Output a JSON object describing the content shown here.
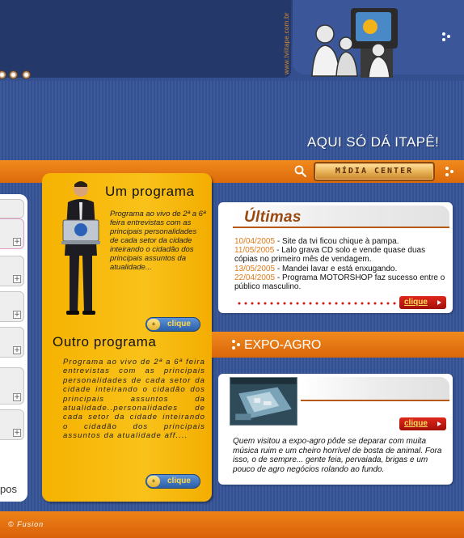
{
  "header": {
    "vertical_url": "www.tviitape.com.br",
    "tagline": "AQUI SÓ DÁ ITAPÊ!"
  },
  "toolbar": {
    "media_center_label": "MÍDIA CENTER"
  },
  "sidebar": {
    "tail_text": "pos"
  },
  "programs": {
    "program1": {
      "title": "Um programa",
      "text": "Programa ao vivo de 2ª a 6ª feira entrevistas com as principais personalidades de cada setor da cidade inteirando o cidadão dos principais assuntos da atualidade...",
      "button_label": "clique"
    },
    "program2": {
      "title": "Outro programa",
      "text": "Programa ao vivo de 2ª a 6ª feira entrevistas com as principais personalidades de cada setor da cidade inteirando o cidadão dos principais assuntos da atualidade..personalidades de cada setor da cidade inteirando o cidadão dos principais assuntos da atualidade aff....",
      "button_label": "clique"
    }
  },
  "ultimas": {
    "title": "Últimas",
    "news": [
      {
        "date": "10/04/2005",
        "text": " - Site da tvi ficou chique à pampa."
      },
      {
        "date": "11/05/2005",
        "text": " - Lalo grava CD solo e vende quase duas cópias no primeiro mês de vendagem."
      },
      {
        "date": "13/05/2005",
        "text": " - Mandei lavar e está enxugando."
      },
      {
        "date": "22/04/2005",
        "text": " - Programa MOTORSHOP faz sucesso entre o público masculino."
      }
    ],
    "button_label": "clique"
  },
  "expo": {
    "title": "EXPO-AGRO",
    "text": "Quem visitou a expo-agro pôde se deparar com muita música ruim e um cheiro horrível de bosta de animal. Fora isso, o de sempre... gente feia, pervaiada, brigas e um pouco de agro negócios rolando ao fundo.",
    "button_label": "clique"
  },
  "footer": {
    "credit": "© Fusion"
  },
  "colors": {
    "background_blue": "#3c5a9c",
    "accent_orange": "#e0740f",
    "panel_yellow": "#f6b200",
    "date_orange": "#e07a1a",
    "button_red": "#c41a12"
  }
}
